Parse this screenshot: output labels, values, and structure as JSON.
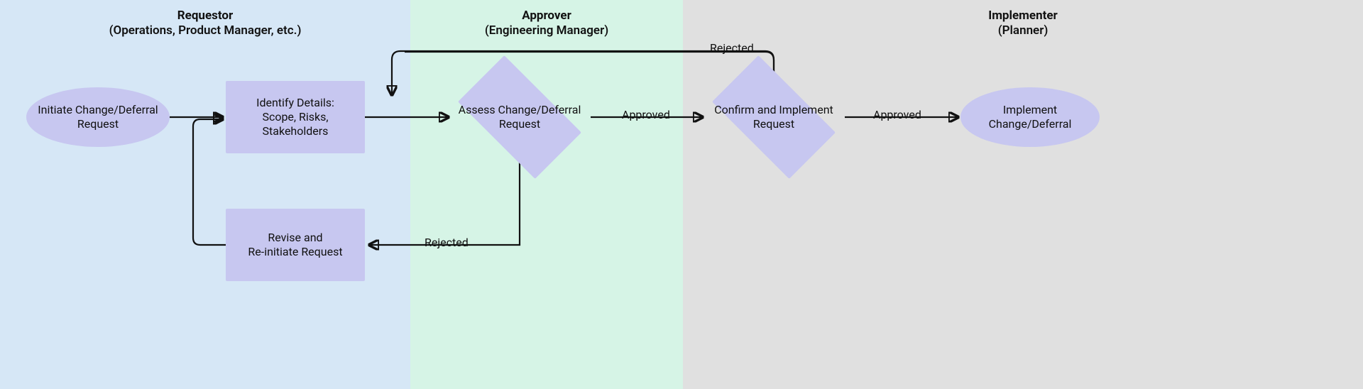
{
  "lanes": {
    "requestor": {
      "role": "Requestor",
      "subtitle": "(Operations, Product Manager, etc.)"
    },
    "approver": {
      "role": "Approver",
      "subtitle": "(Engineering Manager)"
    },
    "implementer": {
      "role": "Implementer",
      "subtitle": "(Planner)"
    }
  },
  "nodes": {
    "initiate": {
      "label": "Initiate Change/Deferral\nRequest"
    },
    "identify": {
      "label": "Identify Details:\nScope, Risks, Stakeholders"
    },
    "revise": {
      "label": "Revise and\nRe-initiate Request"
    },
    "assess": {
      "label": "Assess Change/Deferral\nRequest"
    },
    "confirm": {
      "label": "Confirm and Implement\nRequest"
    },
    "implement": {
      "label": "Implement\nChange/Deferral"
    }
  },
  "edges": {
    "assess_to_confirm": {
      "label": "Approved"
    },
    "assess_to_revise": {
      "label": "Rejected"
    },
    "confirm_to_implement": {
      "label": "Approved"
    },
    "confirm_rejected": {
      "label": "Rejected"
    }
  }
}
